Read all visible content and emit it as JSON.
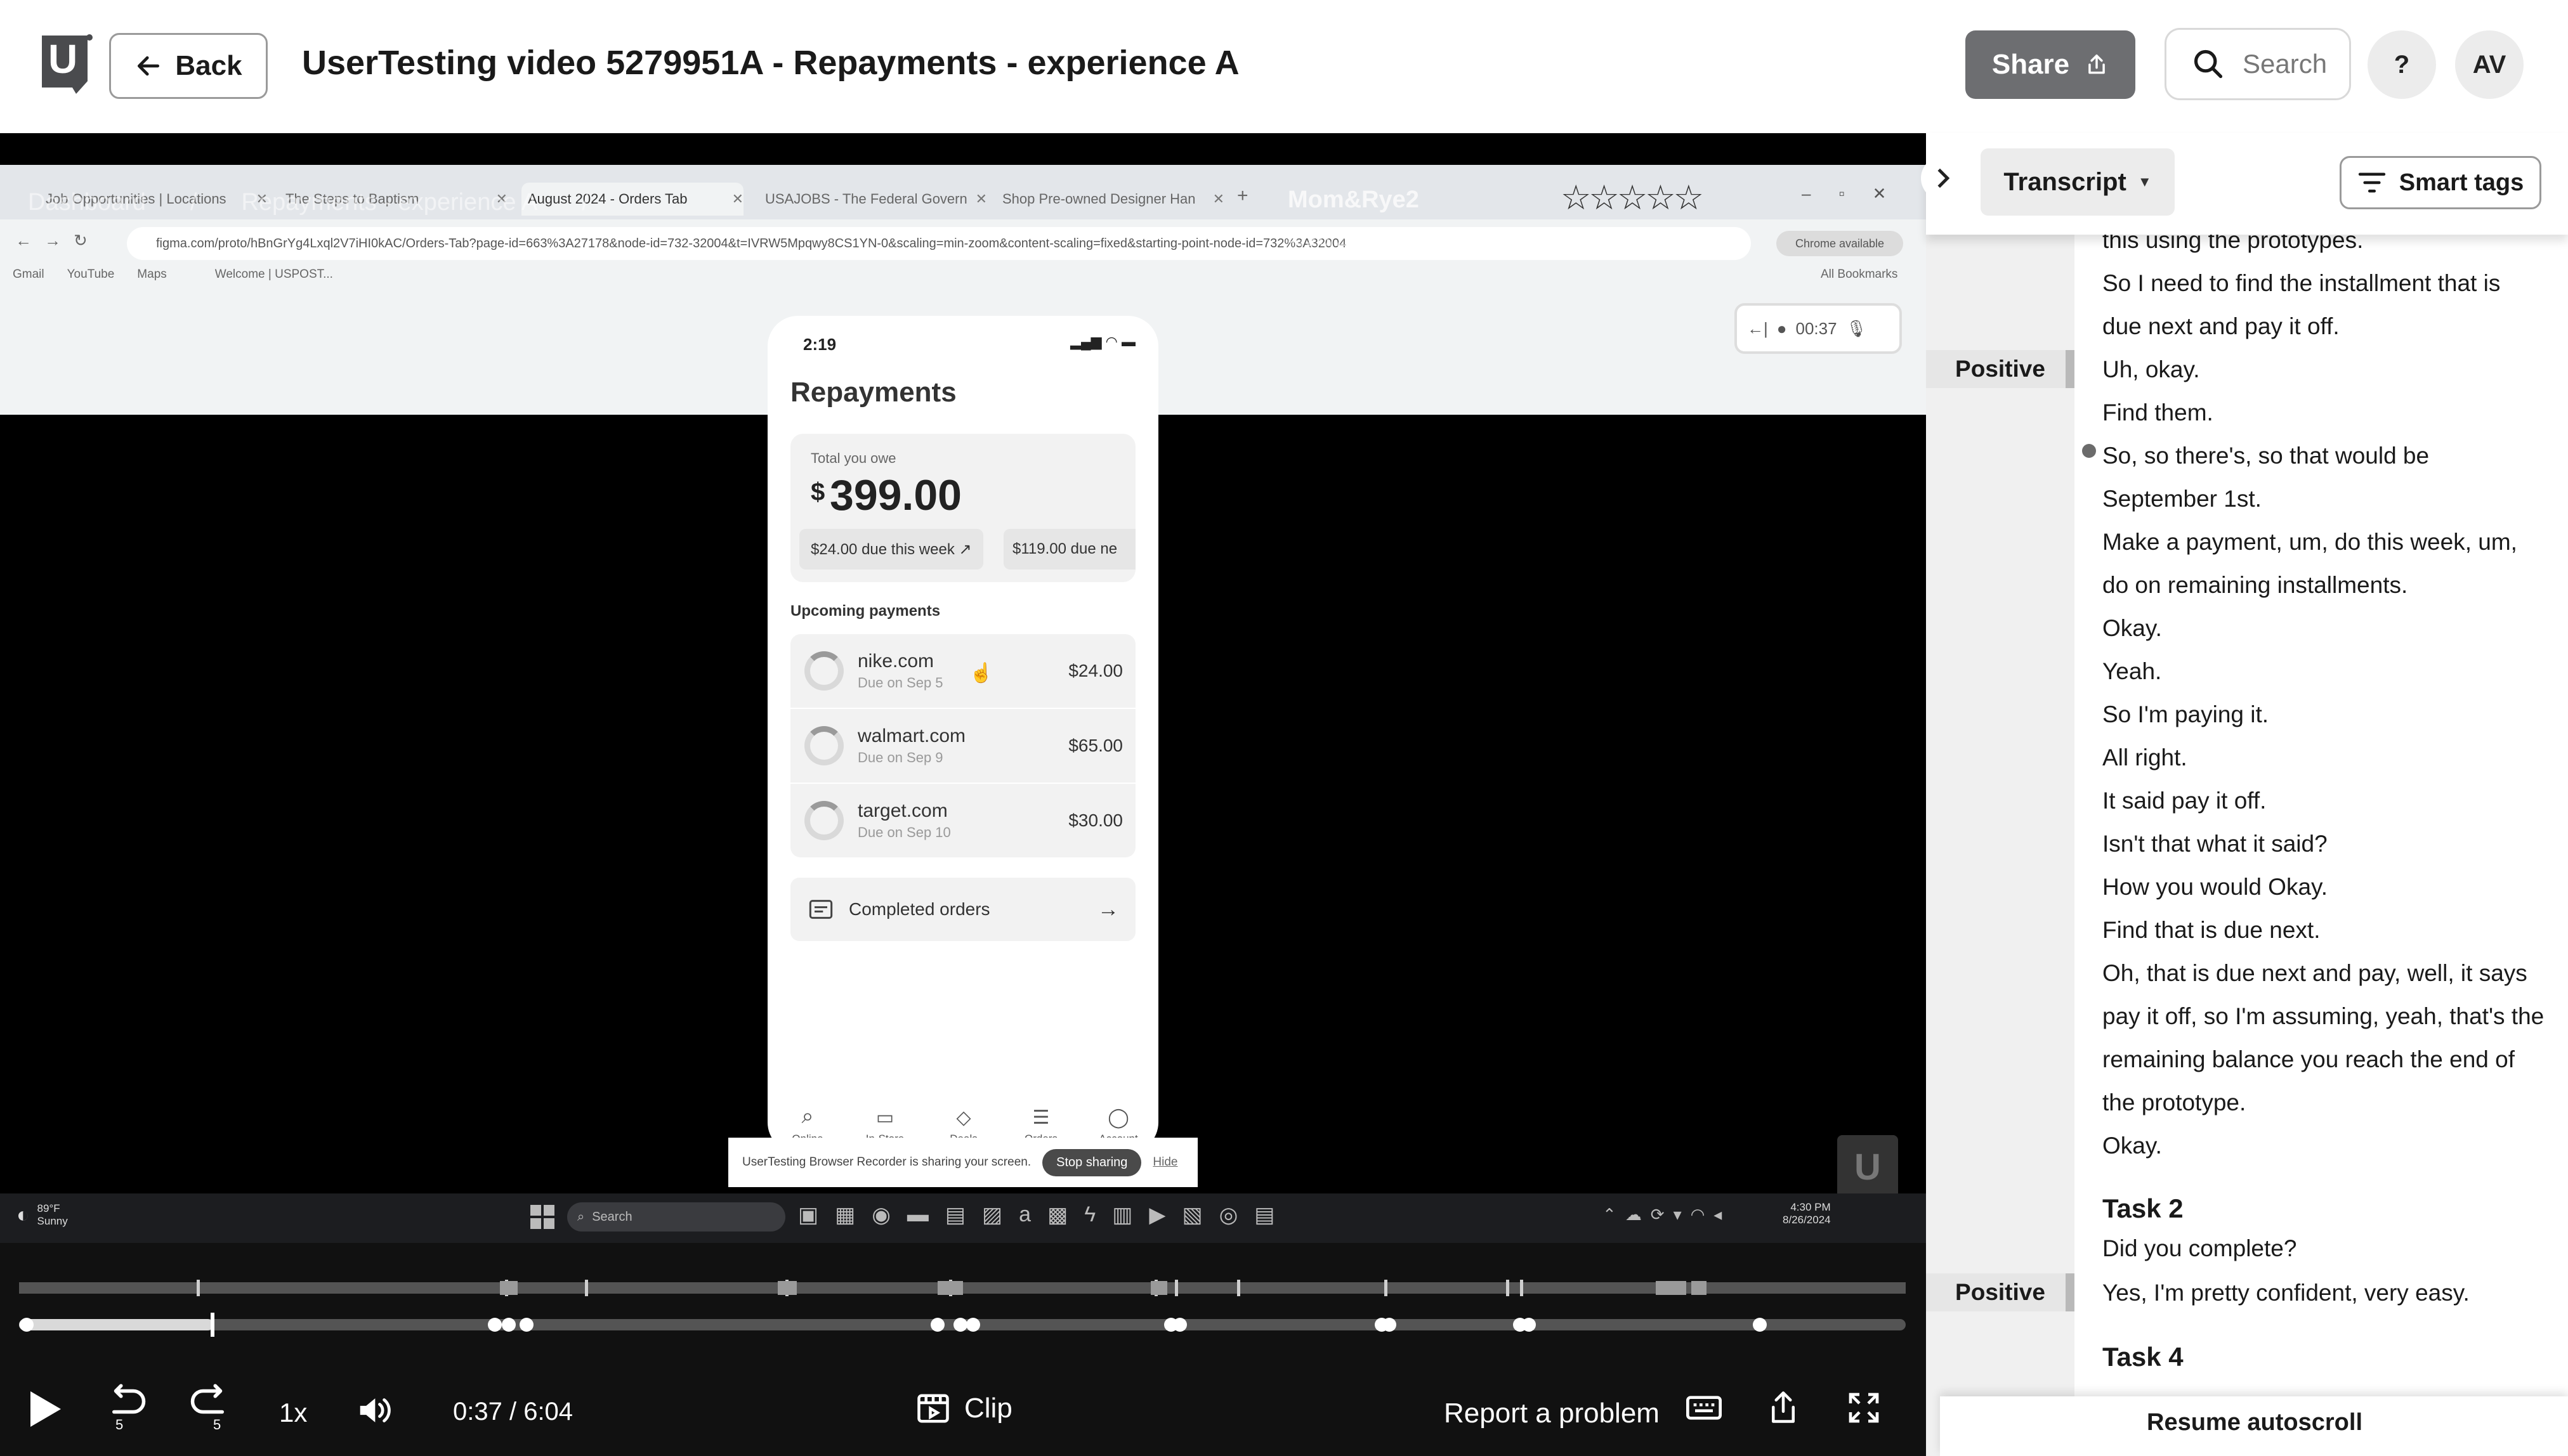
{
  "header": {
    "logo_letter": "U",
    "back_label": "Back",
    "title": "UserTesting video 5279951A - Repayments - experience A",
    "share_label": "Share",
    "search_placeholder": "Search",
    "help_label": "?",
    "avatar_initials": "AV"
  },
  "browser": {
    "tabs": [
      {
        "label": "Job Opportunities | Locations"
      },
      {
        "label": "The Steps to Baptism"
      },
      {
        "label": "August 2024 - Orders Tab"
      },
      {
        "label": "USAJOBS - The Federal Govern"
      },
      {
        "label": "Shop Pre-owned Designer Han"
      }
    ],
    "url": "figma.com/proto/hBnGrYg4Lxql2V7iHI0kAC/Orders-Tab?page-id=663%3A27178&node-id=732-32004&t=IVRW5Mpqwy8CS1YN-0&scaling=min-zoom&content-scaling=fixed&starting-point-node-id=732%3A32004",
    "bookmarks": [
      "Gmail",
      "YouTube",
      "Maps",
      "Welcome | USPOST..."
    ],
    "all_bookmarks": "All Bookmarks",
    "chrome_available": "Chrome available",
    "overlay_breadcrumb": [
      "Dashboard",
      "Repayments - experience A"
    ],
    "overlay_session": "Mom&Rye2",
    "overlay_faded": "4/26/2024 · 51.3 years · 5279951A"
  },
  "phone": {
    "time": "2:19",
    "screen_title": "Repayments",
    "total_label": "Total you owe",
    "total_currency": "$",
    "total_amount": "399.00",
    "pill_1": "$24.00 due this week ↗",
    "pill_2": "$119.00 due ne",
    "upcoming_label": "Upcoming payments",
    "payments": [
      {
        "merchant": "nike.com",
        "due": "Due on Sep 5",
        "amount": "$24.00"
      },
      {
        "merchant": "walmart.com",
        "due": "Due on Sep 9",
        "amount": "$65.00"
      },
      {
        "merchant": "target.com",
        "due": "Due on Sep 10",
        "amount": "$30.00"
      }
    ],
    "completed_label": "Completed orders",
    "nav": [
      "Online",
      "In-Store",
      "Deals",
      "Orders",
      "Account"
    ]
  },
  "recorder": {
    "time": "00:37",
    "sharing_text": "UserTesting Browser Recorder is sharing your screen.",
    "stop_label": "Stop sharing",
    "hide_label": "Hide"
  },
  "taskbar": {
    "weather_temp": "89°F",
    "weather_desc": "Sunny",
    "search_label": "Search",
    "clock_time": "4:30 PM",
    "clock_date": "8/26/2024"
  },
  "player": {
    "speed": "1x",
    "skip_back_seconds": "5",
    "skip_fwd_seconds": "5",
    "time": "0:37 / 6:04",
    "clip_label": "Clip",
    "report_label": "Report a problem"
  },
  "panel": {
    "transcript_label": "Transcript",
    "smart_tags_label": "Smart tags",
    "resume_label": "Resume autoscroll",
    "tag_positive_1": "Positive",
    "tag_positive_2": "Positive",
    "lines": [
      "this using the prototypes.",
      "So I need to find the installment that is",
      "due next and pay it off.",
      "Uh, okay.",
      "Find them.",
      "So, so there's, so that would be",
      "September 1st.",
      "Make a payment, um, do this week, um,",
      "do on remaining installments.",
      "Okay.",
      "Yeah.",
      "So I'm paying it.",
      "All right.",
      "It said pay it off.",
      "Isn't that what it said?",
      "How you would Okay.",
      "Find that is due next.",
      "Oh, that is due next and pay, well, it says",
      "pay it off, so I'm assuming, yeah, that's the",
      "remaining balance you reach the end of",
      "the prototype.",
      "Okay."
    ],
    "task2_heading": "Task 2",
    "task2_lines": [
      "Did you complete?",
      "Yes, I'm pretty confident, very easy."
    ],
    "task4_heading": "Task 4"
  },
  "colors": {
    "share_bg": "#6d6e71",
    "video_bg": "#000000",
    "tag_column": "#f0f0f0",
    "timeline_track": "#545454"
  }
}
